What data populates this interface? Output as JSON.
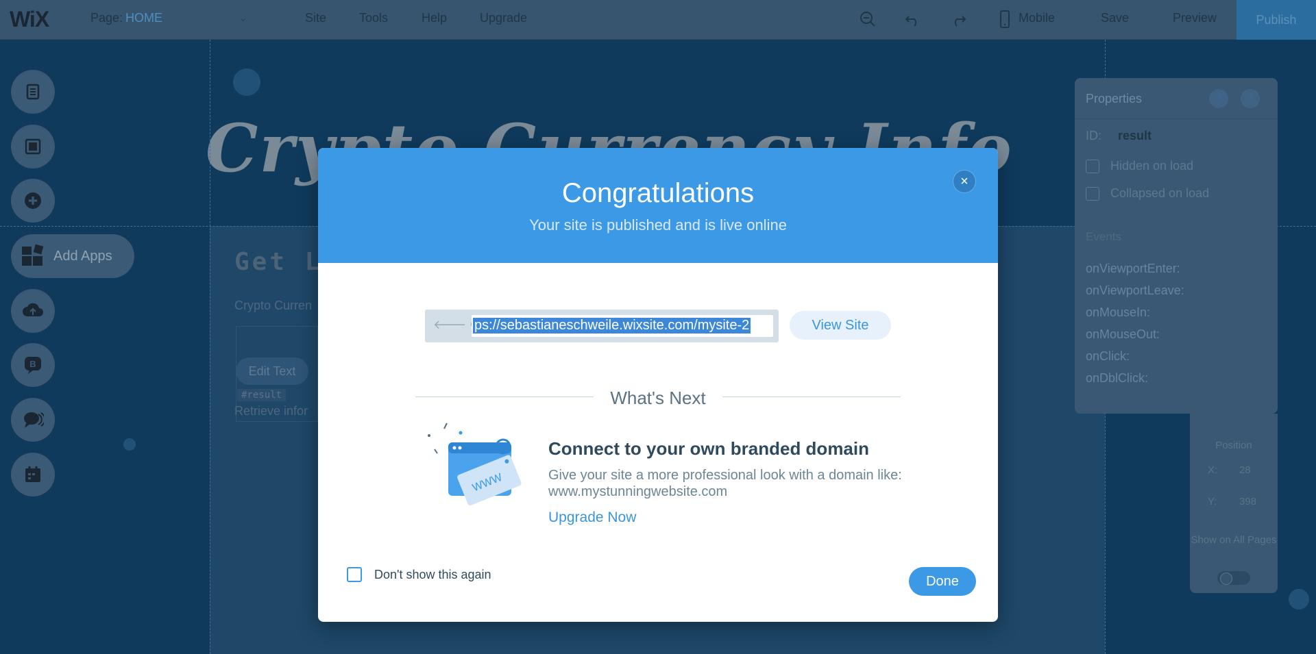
{
  "topbar": {
    "logo": "WiX",
    "page_label": "Page:",
    "page_name": "HOME",
    "menu": [
      "Site",
      "Tools",
      "Help",
      "Upgrade"
    ],
    "mobile_label": "Mobile",
    "save_label": "Save",
    "preview_label": "Preview",
    "publish_label": "Publish"
  },
  "canvas": {
    "hero_title": "Crypto Currency Info",
    "sub_heading": "Get Lat",
    "crypto_line": "Crypto Curren",
    "edit_text_label": "Edit Text",
    "result_tag": "#result",
    "retrieve_text": "Retrieve infor"
  },
  "left_rail": {
    "add_apps_label": "Add Apps",
    "icons": [
      "pages-icon",
      "background-icon",
      "add-icon",
      "apps-icon",
      "upload-icon",
      "blog-icon",
      "chat-icon",
      "bookings-icon"
    ]
  },
  "properties": {
    "title": "Properties",
    "help_symbol": "?",
    "close_symbol": "×",
    "id_label": "ID:",
    "id_value": "result",
    "hidden_label": "Hidden on load",
    "collapsed_label": "Collapsed on load",
    "events_label": "Events",
    "events": [
      "onViewportEnter:",
      "onViewportLeave:",
      "onMouseIn:",
      "onMouseOut:",
      "onClick:",
      "onDblClick:"
    ]
  },
  "position_panel": {
    "title": "Position",
    "x_label": "X:",
    "x_value": "28",
    "y_label": "Y:",
    "y_value": "398",
    "show_all_pages": "Show on All Pages"
  },
  "modal": {
    "title": "Congratulations",
    "subtitle": "Your site is published and is live online",
    "close_symbol": "×",
    "url": "ps://sebastianeschweile.wixsite.com/mysite-2",
    "view_site_label": "View Site",
    "whats_next": "What's Next",
    "domain_title": "Connect to your own branded domain",
    "domain_desc": "Give your site a more professional look with a domain like: www.mystunningwebsite.com",
    "upgrade_label": "Upgrade Now",
    "dont_show_label": "Don't show this again",
    "done_label": "Done",
    "www_text": "WWW"
  },
  "colors": {
    "accent": "#3b99e6",
    "topbar": "#37556e",
    "canvas": "#0f3a5c"
  }
}
